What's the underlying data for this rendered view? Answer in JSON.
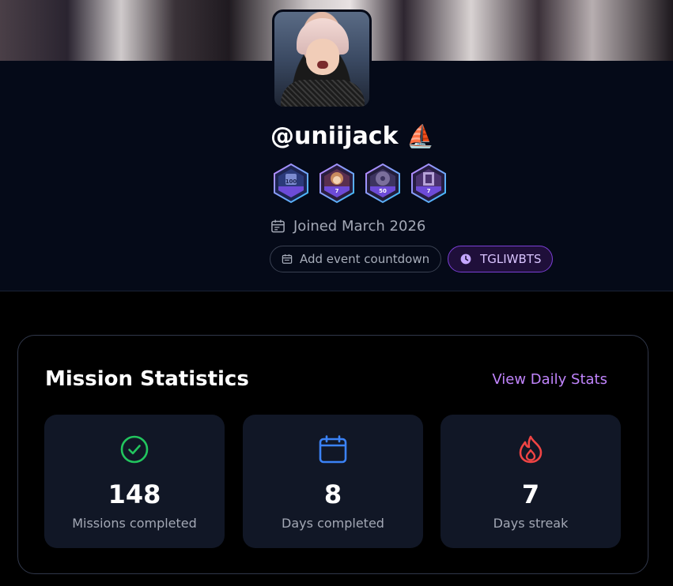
{
  "profile": {
    "username": "@uniijack",
    "username_emoji": "⛵",
    "joined": "Joined March 2026",
    "badges": [
      {
        "name": "badge-100",
        "label": "100",
        "color": "#2b3a7a"
      },
      {
        "name": "badge-monkey-7",
        "label": "7",
        "color": "#6b3a5a"
      },
      {
        "name": "badge-reel-50",
        "label": "50",
        "color": "#4a3a6a"
      },
      {
        "name": "badge-film-7",
        "label": "7",
        "color": "#5a3a7a"
      }
    ],
    "add_countdown_label": "Add event countdown",
    "countdown_tag_label": "TGLIWBTS"
  },
  "stats": {
    "title": "Mission Statistics",
    "view_link": "View Daily Stats",
    "items": [
      {
        "icon": "check-circle-icon",
        "value": "148",
        "label": "Missions completed",
        "color": "#22c55e"
      },
      {
        "icon": "calendar-icon",
        "value": "8",
        "label": "Days completed",
        "color": "#3b82f6"
      },
      {
        "icon": "flame-icon",
        "value": "7",
        "label": "Days streak",
        "color": "#ef4444"
      }
    ]
  },
  "colors": {
    "accent_purple": "#c084fc",
    "background": "#000000",
    "card_bg": "#111726"
  }
}
